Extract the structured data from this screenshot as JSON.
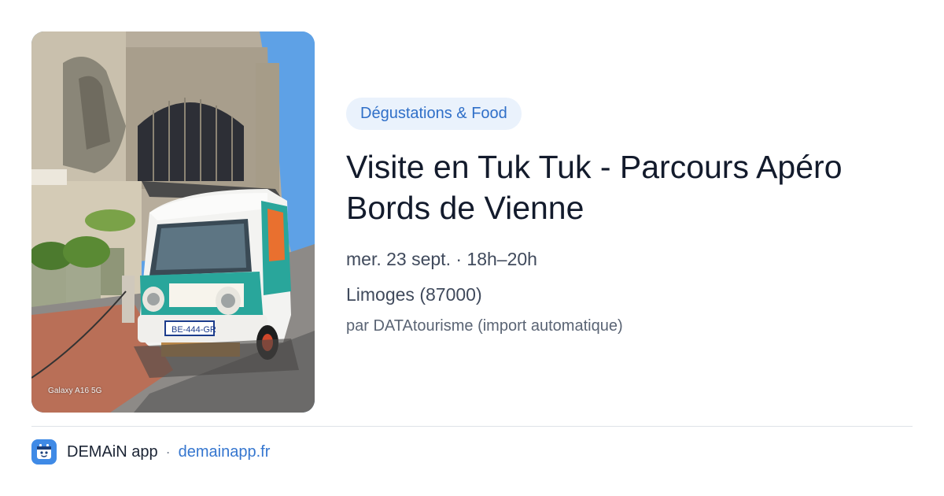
{
  "photo": {
    "alt": "Tuk tuk devant la gare de Limoges",
    "watermark": "Galaxy A16 5G",
    "plate": "BE-444-GR"
  },
  "event": {
    "category": "Dégustations & Food",
    "title": "Visite en Tuk Tuk - Parcours Apéro Bords de Vienne",
    "date": "mer. 23 sept. · 18h–20h",
    "location": "Limoges (87000)",
    "source": "par DATAtourisme (import automatique)"
  },
  "footer": {
    "app_name": "DEMAiN app",
    "separator": "·",
    "link": "demainapp.fr"
  },
  "colors": {
    "accent": "#3576cf",
    "badge_bg": "#eaf2fc",
    "app_icon": "#3f8ae6"
  }
}
